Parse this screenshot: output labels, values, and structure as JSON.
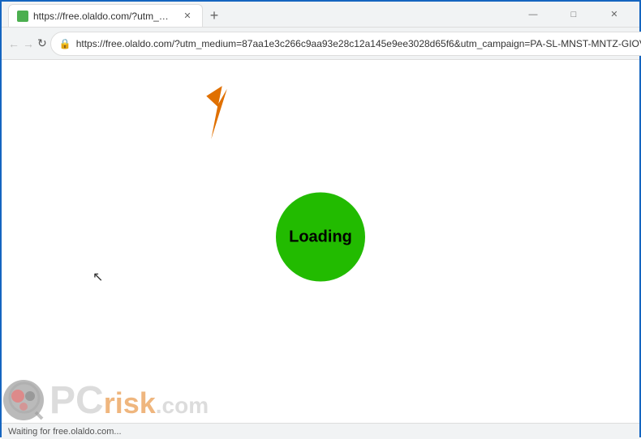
{
  "window": {
    "title": "https://free.olaldo.com/?utm_me...",
    "url": "free.olaldo.com/?utm_medium=87aa1e3c266c9aa93e28c12a145e9ee3028d65f6&utm_campaign=PA-SL-MNST-MNTZ-GIOV-A...",
    "url_full": "https://free.olaldo.com/?utm_medium=87aa1e3c266c9aa93e28c12a145e9ee3028d65f6&utm_campaign=PA-SL-MNST-MNTZ-GIOV-A..."
  },
  "nav": {
    "back_label": "←",
    "forward_label": "→",
    "close_label": "✕",
    "reload_label": "↻",
    "star_label": "☆",
    "menu_label": "⋮"
  },
  "window_controls": {
    "minimize": "—",
    "maximize": "□",
    "close": "✕"
  },
  "tab": {
    "new_tab_label": "+"
  },
  "page": {
    "loading_text": "Loading",
    "status_text": "Waiting for free.olaldo.com..."
  },
  "watermark": {
    "pc_text": "PC",
    "risk_text": "risk",
    "com_text": ".com"
  }
}
